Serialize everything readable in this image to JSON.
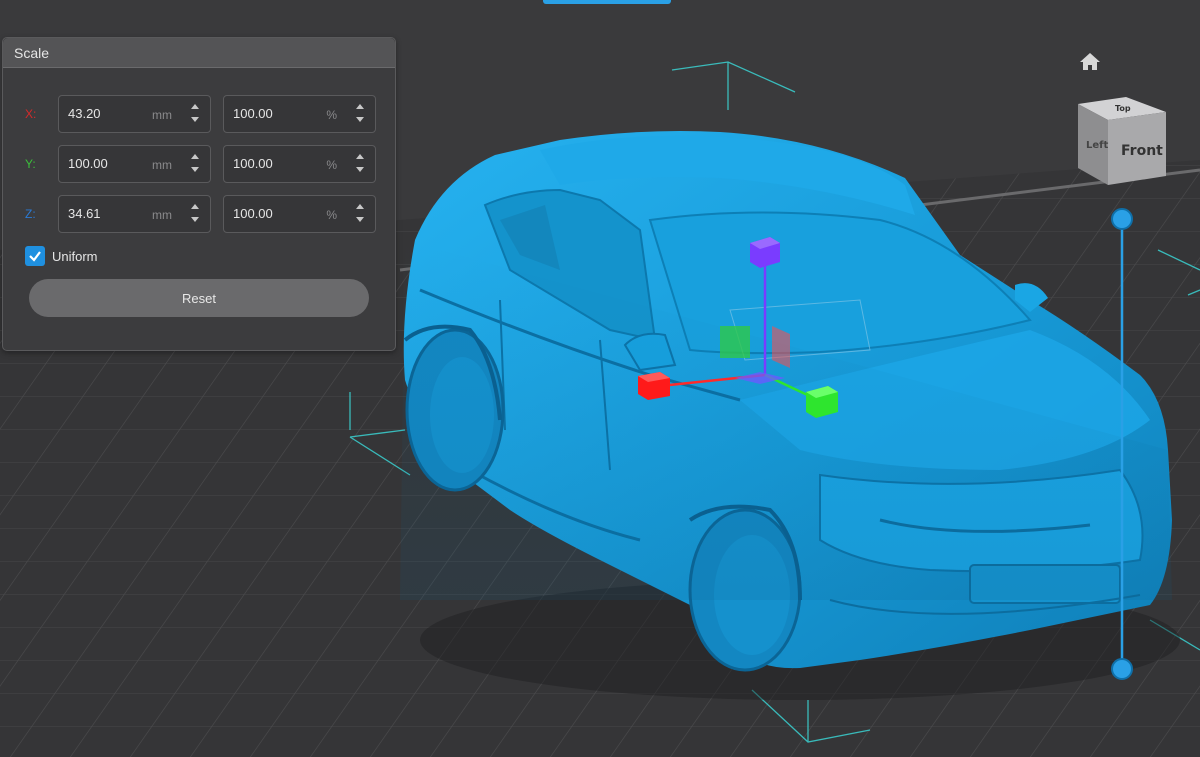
{
  "panel": {
    "title": "Scale",
    "rows": [
      {
        "axis": "X:",
        "axis_color": "#d42a2a",
        "value_mm": "43.20",
        "unit_mm": "mm",
        "value_pct": "100.00",
        "unit_pct": "%"
      },
      {
        "axis": "Y:",
        "axis_color": "#3bbf3b",
        "value_mm": "100.00",
        "unit_mm": "mm",
        "value_pct": "100.00",
        "unit_pct": "%"
      },
      {
        "axis": "Z:",
        "axis_color": "#2a7ad4",
        "value_mm": "34.61",
        "unit_mm": "mm",
        "value_pct": "100.00",
        "unit_pct": "%"
      }
    ],
    "uniform_label": "Uniform",
    "uniform_checked": true,
    "reset_label": "Reset"
  },
  "nav_cube": {
    "top": "Top",
    "front": "Front",
    "left": "Left",
    "home_icon": "home-icon"
  },
  "colors": {
    "model": "#1ba3e3",
    "accent": "#2aa0e6",
    "gizmo_x": "#ff1a1a",
    "gizmo_y": "#2ee52e",
    "gizmo_z": "#7a3cff"
  }
}
